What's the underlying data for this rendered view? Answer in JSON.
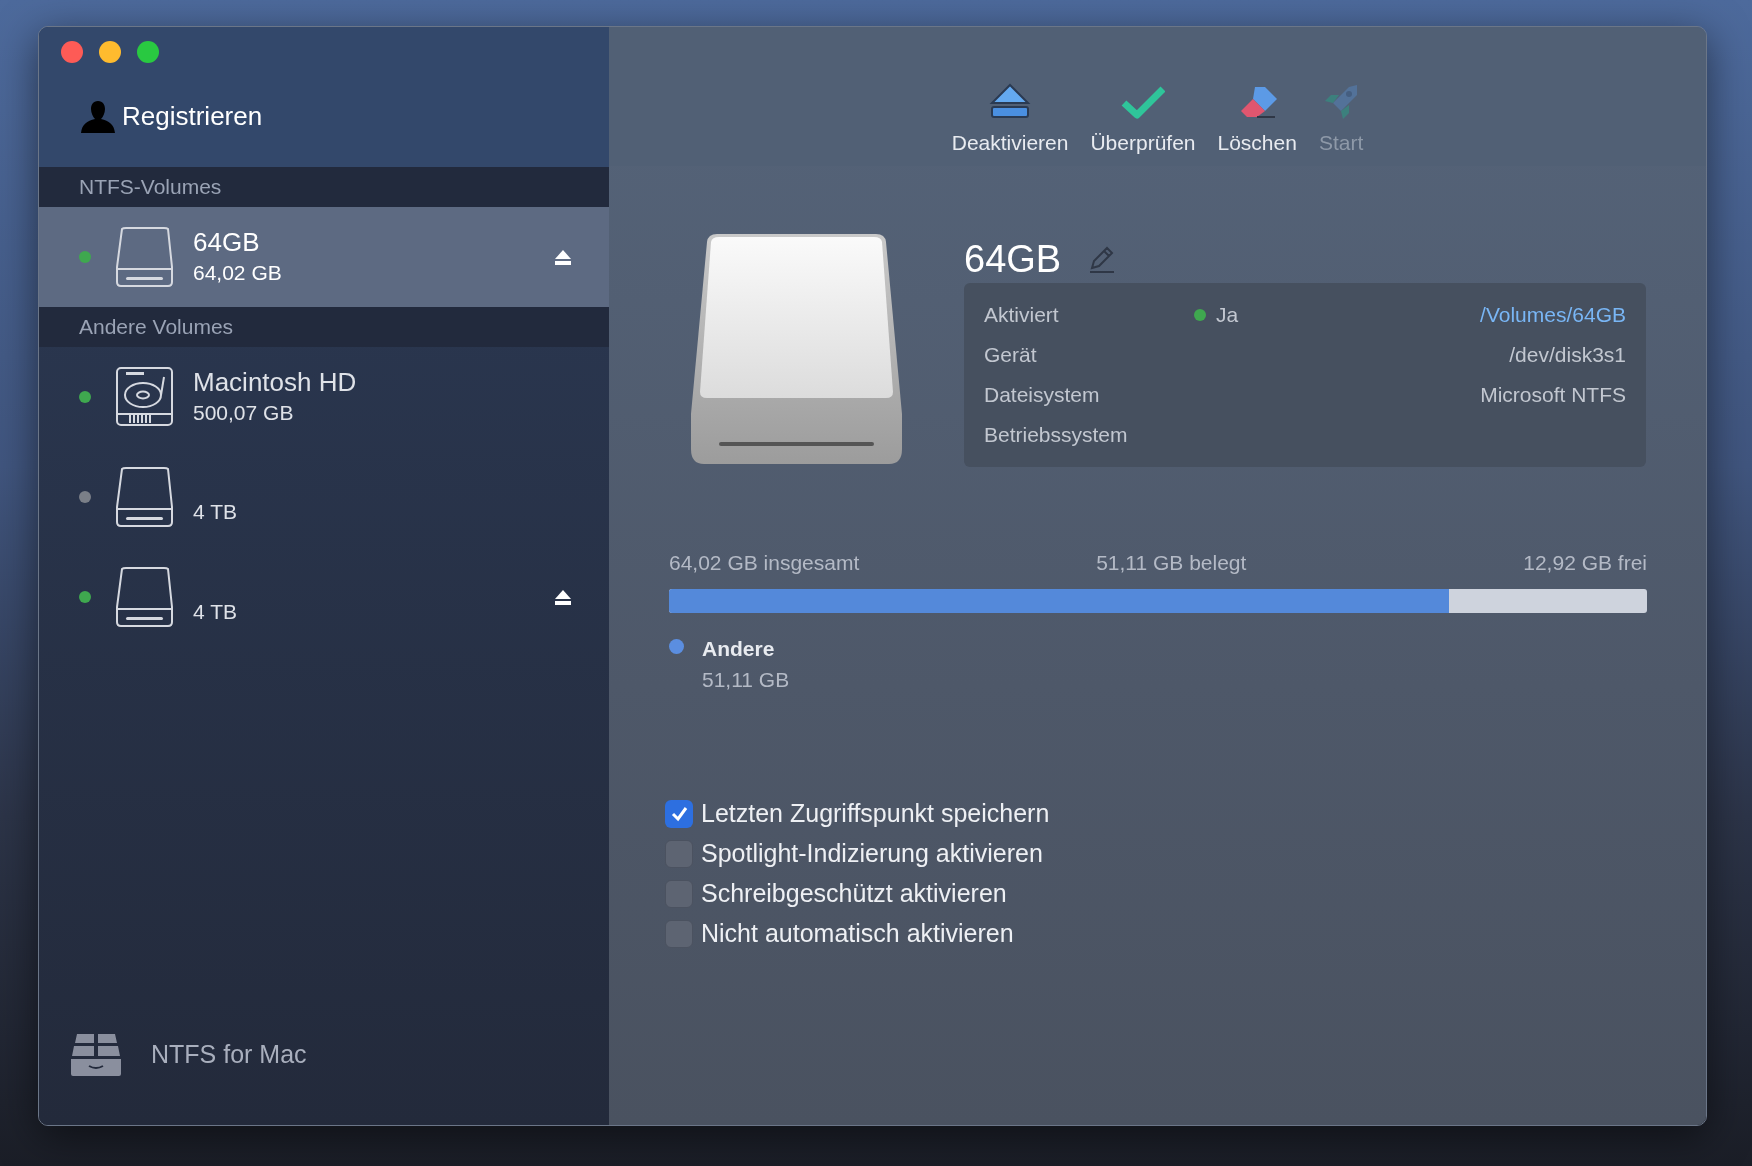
{
  "sidebar": {
    "register_label": "Registrieren",
    "sections": [
      {
        "title": "NTFS-Volumes",
        "volumes": [
          {
            "name": "64GB",
            "size": "64,02 GB",
            "kind": "external",
            "mounted": true,
            "selected": true,
            "ejectable": true
          }
        ]
      },
      {
        "title": "Andere Volumes",
        "volumes": [
          {
            "name": "Macintosh HD",
            "size": "500,07 GB",
            "kind": "internal",
            "mounted": true,
            "selected": false,
            "ejectable": false
          },
          {
            "size": "4 TB",
            "kind": "external",
            "mounted": false,
            "selected": false,
            "ejectable": false
          },
          {
            "size": "4 TB",
            "kind": "external",
            "mounted": true,
            "selected": false,
            "ejectable": true
          }
        ]
      }
    ],
    "footer": "NTFS for Mac"
  },
  "toolbar": [
    {
      "label": "Deaktivieren",
      "kind": "eject",
      "disabled": false
    },
    {
      "label": "Überprüfen",
      "kind": "verify",
      "disabled": false
    },
    {
      "label": "Löschen",
      "kind": "erase",
      "disabled": false
    },
    {
      "label": "Start",
      "kind": "launch",
      "disabled": true
    }
  ],
  "detail": {
    "title": "64GB",
    "info": [
      {
        "label": "Aktiviert",
        "status": "Ja",
        "on": true,
        "value": "/Volumes/64GB",
        "link": true
      },
      {
        "label": "Gerät",
        "value": "/dev/disk3s1",
        "link": false
      },
      {
        "label": "Dateisystem",
        "value": "Microsoft NTFS",
        "link": false
      },
      {
        "label": "Betriebssystem"
      }
    ]
  },
  "storage": {
    "total": "64,02 GB insgesamt",
    "used": "51,11 GB belegt",
    "free": "12,92 GB frei",
    "level": 0.798,
    "legend": [
      {
        "name": "Andere",
        "size": "51,11 GB",
        "color": "#5b8ee0"
      }
    ]
  },
  "options": [
    {
      "label": "Letzten Zugriffspunkt speichern",
      "checked": true
    },
    {
      "label": "Spotlight-Indizierung aktivieren",
      "checked": false
    },
    {
      "label": "Schreibgeschützt aktivieren",
      "checked": false
    },
    {
      "label": "Nicht automatisch aktivieren",
      "checked": false
    }
  ]
}
